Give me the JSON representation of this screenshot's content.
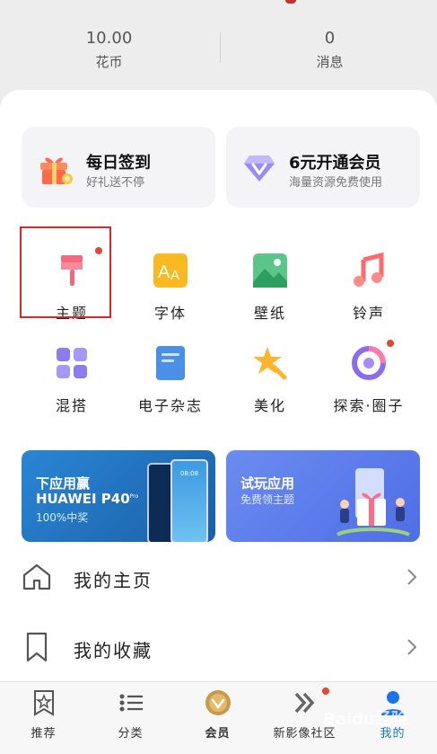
{
  "stats": [
    {
      "value": "10.00",
      "label": "花币"
    },
    {
      "value": "0",
      "label": "消息"
    }
  ],
  "cards": [
    {
      "title": "每日签到",
      "subtitle": "好礼送不停",
      "icon": "gift-icon"
    },
    {
      "title": "6元开通会员",
      "subtitle": "海量资源免费使用",
      "icon": "diamond-icon"
    }
  ],
  "grid": [
    {
      "label": "主题",
      "icon": "brush-icon",
      "dot": true
    },
    {
      "label": "字体",
      "icon": "font-icon"
    },
    {
      "label": "壁纸",
      "icon": "wallpaper-icon"
    },
    {
      "label": "铃声",
      "icon": "music-note-icon"
    },
    {
      "label": "混搭",
      "icon": "mix-grid-icon"
    },
    {
      "label": "电子杂志",
      "icon": "magazine-icon"
    },
    {
      "label": "美化",
      "icon": "star-wand-icon"
    },
    {
      "label": "探索·圈子",
      "icon": "circle-explore-icon",
      "dot": true
    }
  ],
  "banners": [
    {
      "line1": "下应用赢",
      "line2": "HUAWEI P40",
      "line2_sup": "Pro",
      "line3": "100%中奖",
      "screen_time": "08:08",
      "color": "#1d6fb8"
    },
    {
      "line1": "试玩应用",
      "line2": "免费领主题",
      "color": "#5b7be8"
    }
  ],
  "menu": [
    {
      "label": "我的主页",
      "icon": "home-icon"
    },
    {
      "label": "我的收藏",
      "icon": "bookmark-icon"
    }
  ],
  "tabs": [
    {
      "label": "推荐",
      "icon": "star-page-icon"
    },
    {
      "label": "分类",
      "icon": "category-list-icon"
    },
    {
      "label": "会员",
      "icon": "vip-badge-icon"
    },
    {
      "label": "新影像社区",
      "icon": "double-chevron-icon",
      "dot": true
    },
    {
      "label": "我的",
      "icon": "person-icon",
      "active": true
    }
  ],
  "watermark": "Baidu经验",
  "colors": {
    "accent": "#1a73e8",
    "highlight_box": "#d6262c",
    "red_dot": "#e8452f"
  }
}
